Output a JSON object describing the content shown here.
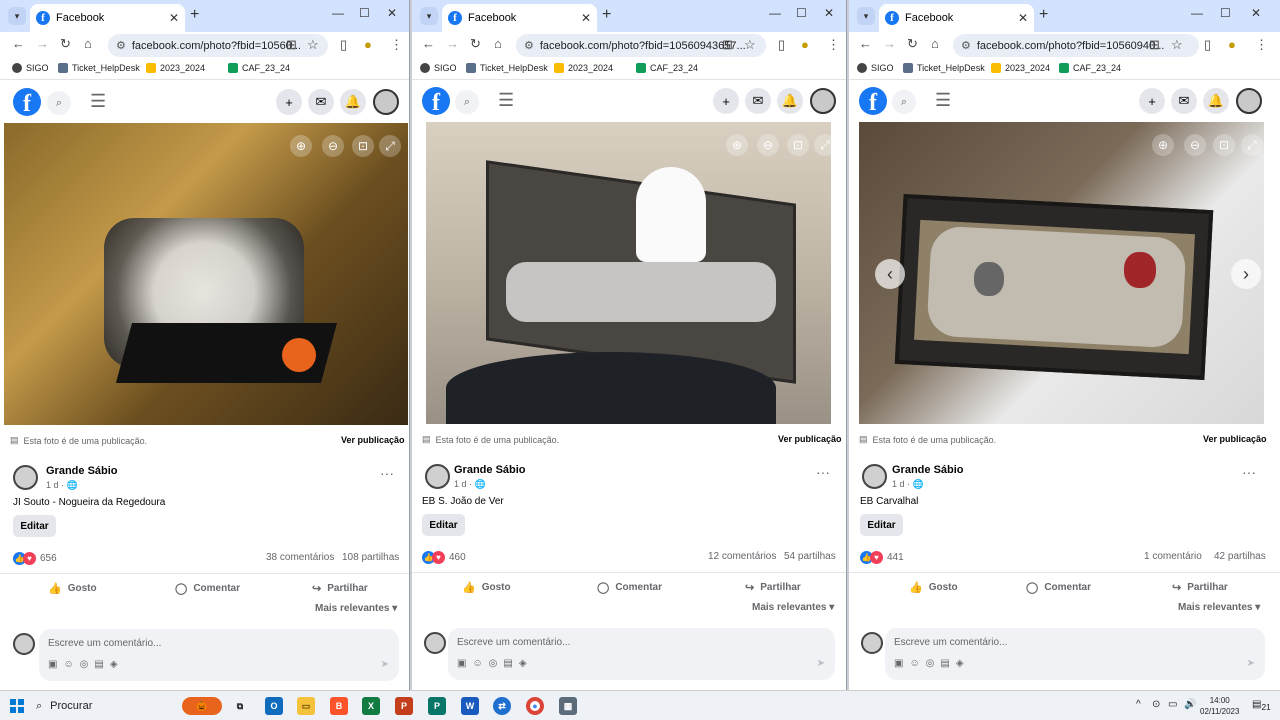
{
  "windows": [
    {
      "tab_title": "Facebook",
      "url": "facebook.com/photo?fbid=10560...",
      "photo_note": "Esta foto é de uma publicação.",
      "view_post": "Ver publicação",
      "author": "Grande Sábio",
      "time": "1 d · ",
      "text": "JI Souto - Nogueira da Regedoura",
      "edit": "Editar",
      "reactions": "656",
      "comments": "38 comentários",
      "shares": "108 partilhas",
      "like": "Gosto",
      "comment": "Comentar",
      "share": "Partilhar",
      "relevant": "Mais relevantes",
      "comment_placeholder": "Escreve um comentário..."
    },
    {
      "tab_title": "Facebook",
      "url": "facebook.com/photo?fbid=10560943657...",
      "photo_note": "Esta foto é de uma publicação.",
      "view_post": "Ver publicação",
      "author": "Grande Sábio",
      "time": "1 d · ",
      "text": "EB S. João de Ver",
      "edit": "Editar",
      "reactions": "460",
      "comments": "12 comentários",
      "shares": "54 partilhas",
      "like": "Gosto",
      "comment": "Comentar",
      "share": "Partilhar",
      "relevant": "Mais relevantes",
      "comment_placeholder": "Escreve um comentário..."
    },
    {
      "tab_title": "Facebook",
      "url": "facebook.com/photo?fbid=10560940...",
      "photo_note": "Esta foto é de uma publicação.",
      "view_post": "Ver publicação",
      "author": "Grande Sábio",
      "time": "1 d · ",
      "text": "EB Carvalhal",
      "edit": "Editar",
      "reactions": "441",
      "comments": "1 comentário",
      "shares": "42 partilhas",
      "like": "Gosto",
      "comment": "Comentar",
      "share": "Partilhar",
      "relevant": "Mais relevantes",
      "comment_placeholder": "Escreve um comentário..."
    }
  ],
  "bookmarks": [
    "SIGO",
    "Ticket_HelpDesk",
    "2023_2024",
    "CAF_23_24"
  ],
  "taskbar": {
    "search_label": "Procurar",
    "time": "14:00",
    "date": "02/11/2023",
    "notifications": "21"
  },
  "colors": {
    "facebook_blue": "#1877f2",
    "love_red": "#f33e58",
    "tab_bar": "#d3e3fd"
  }
}
